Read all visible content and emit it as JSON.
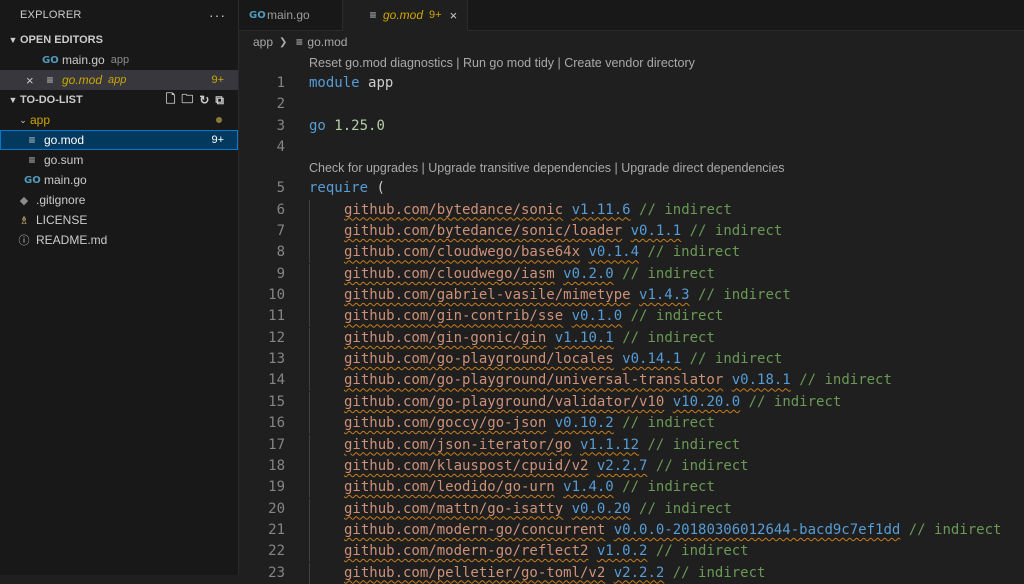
{
  "explorer": {
    "title": "EXPLORER",
    "more": "···",
    "open_editors": {
      "title": "OPEN EDITORS",
      "items": [
        {
          "name": "main.go",
          "folder": "app",
          "icon": "go-icon"
        },
        {
          "name": "go.mod",
          "folder": "app",
          "badge": "9+",
          "icon": "lines-icon",
          "close": "×"
        }
      ]
    },
    "project": {
      "title": "TO-DO-LIST",
      "folder": "app",
      "folder_children": [
        {
          "name": "go.mod",
          "badge": "9+"
        },
        {
          "name": "go.sum"
        },
        {
          "name": "main.go"
        }
      ],
      "root_files": [
        {
          "name": ".gitignore"
        },
        {
          "name": "LICENSE"
        },
        {
          "name": "README.md"
        }
      ]
    }
  },
  "tabs": [
    {
      "name": "main.go",
      "active": false
    },
    {
      "name": "go.mod",
      "badge": "9+",
      "close": "×",
      "active": true
    }
  ],
  "breadcrumb": [
    "app",
    "go.mod"
  ],
  "codelens": {
    "top": "Reset go.mod diagnostics | Run go mod tidy | Create vendor directory",
    "require": "Check for upgrades | Upgrade transitive dependencies | Upgrade direct dependencies"
  },
  "code": {
    "module_kw": "module",
    "module_name": "app",
    "go_kw": "go",
    "go_version": "1.25.0",
    "require_kw": "require",
    "require_paren": "(",
    "comment": "// indirect",
    "deps": [
      {
        "ln": "6",
        "mod": "github.com/bytedance/sonic",
        "ver": "v1.11.6"
      },
      {
        "ln": "7",
        "mod": "github.com/bytedance/sonic/loader",
        "ver": "v0.1.1"
      },
      {
        "ln": "8",
        "mod": "github.com/cloudwego/base64x",
        "ver": "v0.1.4"
      },
      {
        "ln": "9",
        "mod": "github.com/cloudwego/iasm",
        "ver": "v0.2.0"
      },
      {
        "ln": "10",
        "mod": "github.com/gabriel-vasile/mimetype",
        "ver": "v1.4.3"
      },
      {
        "ln": "11",
        "mod": "github.com/gin-contrib/sse",
        "ver": "v0.1.0"
      },
      {
        "ln": "12",
        "mod": "github.com/gin-gonic/gin",
        "ver": "v1.10.1"
      },
      {
        "ln": "13",
        "mod": "github.com/go-playground/locales",
        "ver": "v0.14.1"
      },
      {
        "ln": "14",
        "mod": "github.com/go-playground/universal-translator",
        "ver": "v0.18.1"
      },
      {
        "ln": "15",
        "mod": "github.com/go-playground/validator/v10",
        "ver": "v10.20.0"
      },
      {
        "ln": "16",
        "mod": "github.com/goccy/go-json",
        "ver": "v0.10.2"
      },
      {
        "ln": "17",
        "mod": "github.com/json-iterator/go",
        "ver": "v1.1.12"
      },
      {
        "ln": "18",
        "mod": "github.com/klauspost/cpuid/v2",
        "ver": "v2.2.7"
      },
      {
        "ln": "19",
        "mod": "github.com/leodido/go-urn",
        "ver": "v1.4.0"
      },
      {
        "ln": "20",
        "mod": "github.com/mattn/go-isatty",
        "ver": "v0.0.20"
      },
      {
        "ln": "21",
        "mod": "github.com/modern-go/concurrent",
        "ver": "v0.0.0-20180306012644-bacd9c7ef1dd"
      },
      {
        "ln": "22",
        "mod": "github.com/modern-go/reflect2",
        "ver": "v1.0.2"
      },
      {
        "ln": "23",
        "mod": "github.com/pelletier/go-toml/v2",
        "ver": "v2.2.2"
      }
    ]
  },
  "line_numbers": {
    "l1": "1",
    "l2": "2",
    "l3": "3",
    "l4": "4",
    "l5": "5"
  },
  "colors": {
    "accent": "#0078d4",
    "warning": "#cca700",
    "keyword": "#569cd6",
    "string": "#ce9178",
    "comment": "#6a9955"
  }
}
